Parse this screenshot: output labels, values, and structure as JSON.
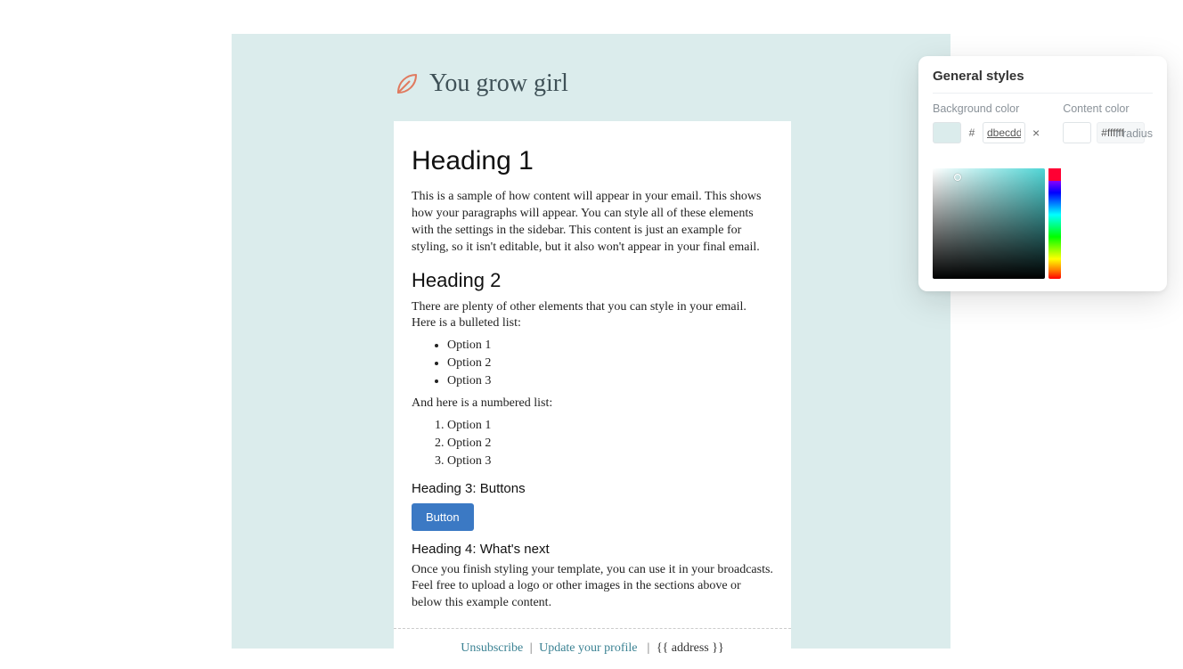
{
  "brand": {
    "title": "You grow girl",
    "icon_name": "leaf-icon",
    "icon_color": "#e07a5f",
    "title_color": "#3f5157"
  },
  "content": {
    "heading1": "Heading 1",
    "paragraph1": "This is a sample of how content will appear in your email. This shows how your paragraphs will appear. You can style all of these elements with the settings in the sidebar. This content is just an example for styling, so it isn't editable, but it also won't appear in your final email.",
    "heading2": "Heading 2",
    "paragraph2": "There are plenty of other elements that you can style in your email. Here is a bulleted list:",
    "bullets": [
      "Option 1",
      "Option 2",
      "Option 3"
    ],
    "numbered_intro": "And here is a numbered list:",
    "numbered": [
      "Option 1",
      "Option 2",
      "Option 3"
    ],
    "heading3": "Heading 3: Buttons",
    "button_label": "Button",
    "heading4": "Heading 4: What's next",
    "paragraph3": "Once you finish styling your template, you can use it in your broadcasts. Feel free to upload a logo or other images in the sections above or below this example content."
  },
  "footer": {
    "unsubscribe": "Unsubscribe",
    "update_profile": "Update your profile",
    "address_token": "{{ address }}"
  },
  "panel": {
    "title": "General styles",
    "background_label": "Background color",
    "content_label": "Content color",
    "hash": "#",
    "background_hex": "dbecdd",
    "content_hex": "#ffffff",
    "clear_label": "×",
    "radius_label": "r radius",
    "background_swatch": "#dbecec",
    "content_swatch": "#ffffff"
  },
  "colors": {
    "canvas_bg": "#dbecec",
    "card_bg": "#ffffff",
    "button_bg": "#3b79c4",
    "link_color": "#3b8293"
  }
}
